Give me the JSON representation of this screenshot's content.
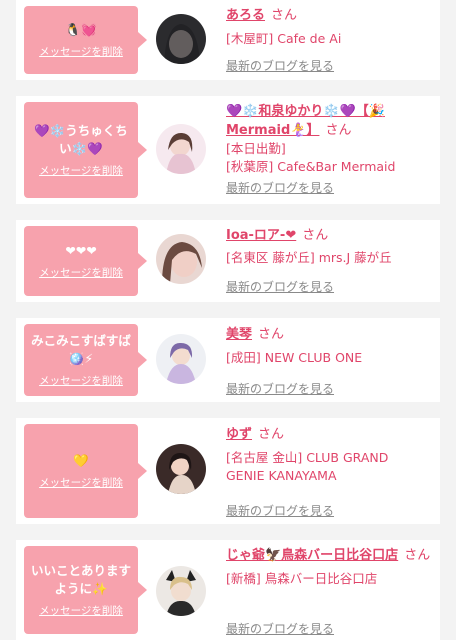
{
  "delete_label": "メッセージを削除",
  "blog_label": "最新のブログを見る",
  "suffix": "さん",
  "items": [
    {
      "message": "🐧💓",
      "name": "あろる",
      "shop": "[木屋町] Cafe de Ai"
    },
    {
      "message": "💜❄️うちゅくち\nい❄️💜",
      "name": "💜❄️和泉ゆかり❄️💜【🎉\nMermaid🧜‍♀️】",
      "shop": "[本日出勤]\n[秋葉原] Cafe&Bar Mermaid"
    },
    {
      "message": "❤❤❤",
      "name": "Ioa-ロア-❤",
      "shop": "[名東区 藤が丘] mrs.J 藤が丘"
    },
    {
      "message": "みこみこすばすば\n🪩⚡",
      "name": "美琴",
      "shop": "[成田] NEW CLUB ONE"
    },
    {
      "message": "💛",
      "name": "ゆず",
      "shop": "[名古屋 金山] CLUB GRAND\nGENIE KANAYAMA"
    },
    {
      "message": "いいことあります\nように✨",
      "name": "じゃ爺🦅鳥森バー日比谷口店",
      "shop": "[新橋] 鳥森バー日比谷口店"
    }
  ]
}
